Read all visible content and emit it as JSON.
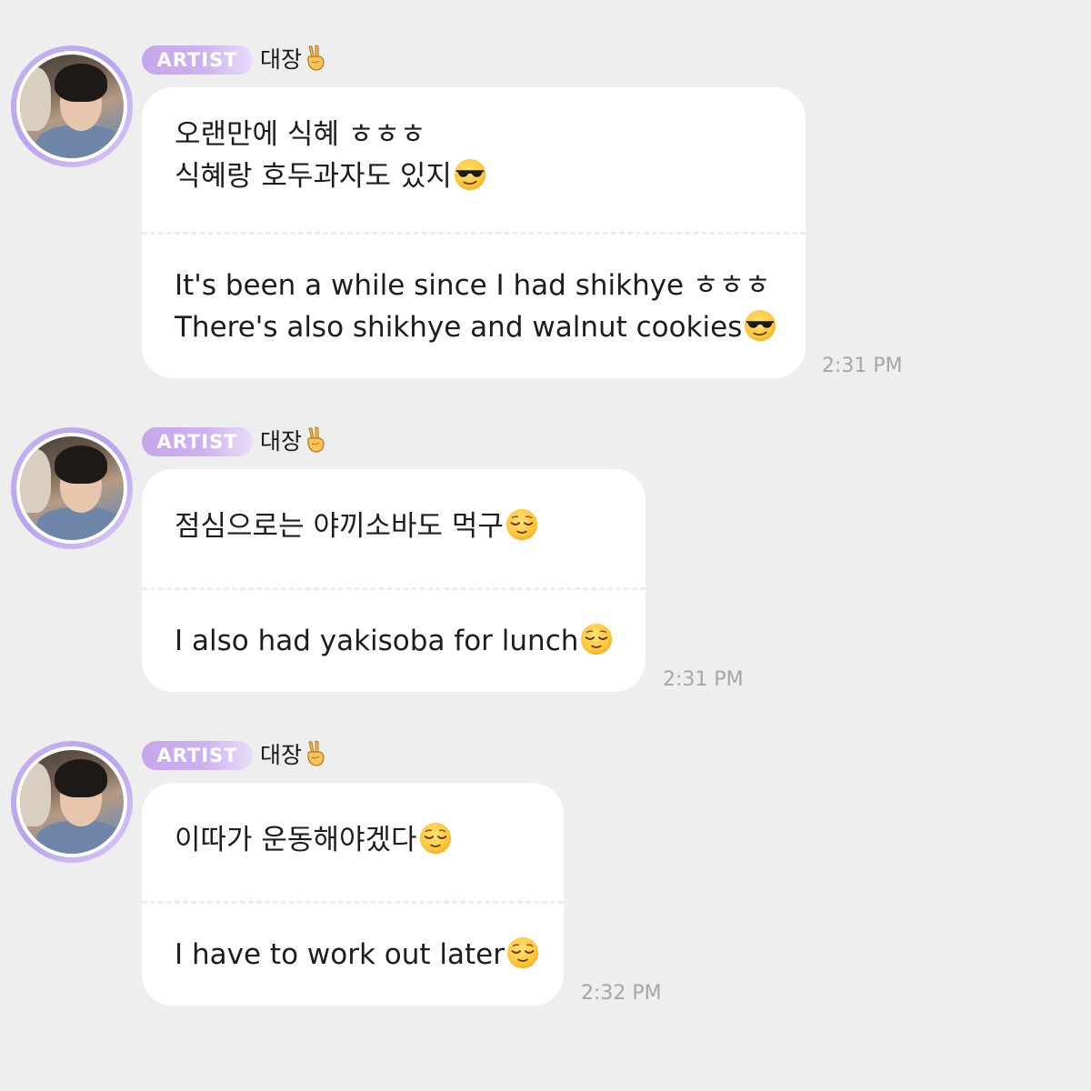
{
  "messages": [
    {
      "badge": "ARTIST",
      "sender": "대장",
      "sender_emoji": "victory-hand",
      "korean_lines": [
        "오랜만에 식혜 ㅎㅎㅎ",
        "식혜랑 호두과자도 있지"
      ],
      "korean_emoji": "sunglasses-face",
      "english_lines": [
        "It's been a while since I had shikhye ㅎㅎㅎ",
        "There's also shikhye and walnut cookies"
      ],
      "english_emoji": "sunglasses-face",
      "time": "2:31 PM"
    },
    {
      "badge": "ARTIST",
      "sender": "대장",
      "sender_emoji": "victory-hand",
      "korean_lines": [
        "점심으로는 야끼소바도 먹구"
      ],
      "korean_emoji": "relieved-face",
      "english_lines": [
        "I also had yakisoba for lunch"
      ],
      "english_emoji": "relieved-face",
      "time": "2:31 PM"
    },
    {
      "badge": "ARTIST",
      "sender": "대장",
      "sender_emoji": "victory-hand",
      "korean_lines": [
        "이따가 운동해야겠다"
      ],
      "korean_emoji": "relieved-face",
      "english_lines": [
        "I have to work out later"
      ],
      "english_emoji": "relieved-face",
      "time": "2:32 PM"
    }
  ],
  "colors": {
    "background": "#eeeeee",
    "bubble": "#ffffff",
    "badge_start": "#c6a6ec",
    "badge_end": "#e8ddf8",
    "avatar_ring": "#c9b4f0",
    "timestamp": "#a6a6a6",
    "text": "#1d1d1d"
  }
}
